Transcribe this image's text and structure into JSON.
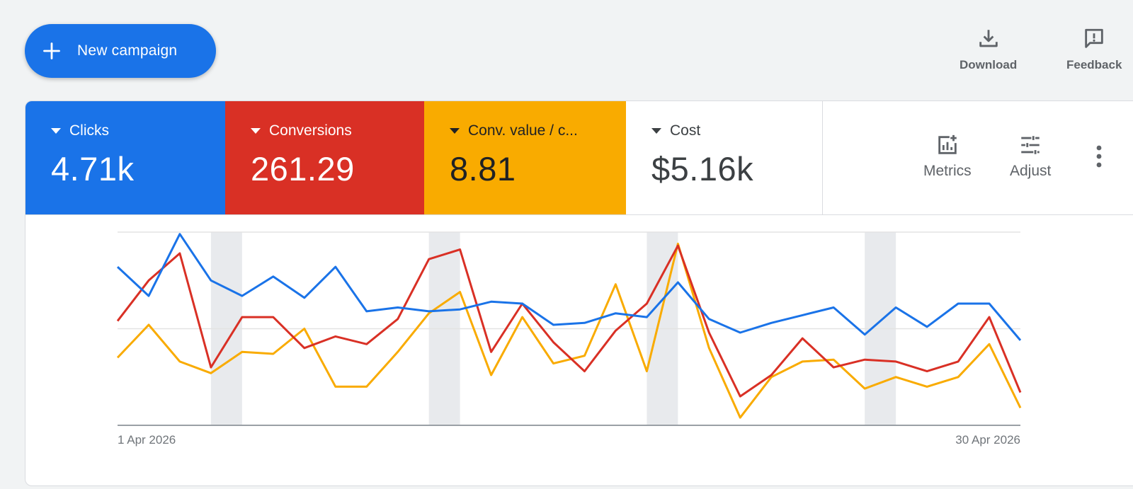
{
  "toolbar": {
    "new_campaign_label": "New campaign",
    "download_label": "Download",
    "feedback_label": "Feedback"
  },
  "metrics": {
    "clicks": {
      "name": "Clicks",
      "value": "4.71k",
      "color": "#1a73e8"
    },
    "conversions": {
      "name": "Conversions",
      "value": "261.29",
      "color": "#d93025"
    },
    "conv_value": {
      "name": "Conv. value / c...",
      "value": "8.81",
      "color": "#f9ab00"
    },
    "cost": {
      "name": "Cost",
      "value": "$5.16k"
    }
  },
  "tools": {
    "metrics_label": "Metrics",
    "adjust_label": "Adjust"
  },
  "icons": {
    "new_campaign": "plus-icon",
    "download": "download-icon",
    "feedback": "feedback-icon",
    "metrics": "add-chart-icon",
    "adjust": "tune-icon",
    "more": "more-vert-icon"
  },
  "chart_data": {
    "type": "line",
    "x": [
      "1 Apr 2026",
      "2 Apr 2026",
      "3 Apr 2026",
      "4 Apr 2026",
      "5 Apr 2026",
      "6 Apr 2026",
      "7 Apr 2026",
      "8 Apr 2026",
      "9 Apr 2026",
      "10 Apr 2026",
      "11 Apr 2026",
      "12 Apr 2026",
      "13 Apr 2026",
      "14 Apr 2026",
      "15 Apr 2026",
      "16 Apr 2026",
      "17 Apr 2026",
      "18 Apr 2026",
      "19 Apr 2026",
      "20 Apr 2026",
      "21 Apr 2026",
      "22 Apr 2026",
      "23 Apr 2026",
      "24 Apr 2026",
      "25 Apr 2026",
      "26 Apr 2026",
      "27 Apr 2026",
      "28 Apr 2026",
      "29 Apr 2026",
      "30 Apr 2026"
    ],
    "x_tick_labels": [
      "1 Apr 2026",
      "30 Apr 2026"
    ],
    "ylim": [
      0,
      100
    ],
    "grid": true,
    "weekend_bands": [
      [
        "4 Apr 2026",
        "5 Apr 2026"
      ],
      [
        "11 Apr 2026",
        "12 Apr 2026"
      ],
      [
        "18 Apr 2026",
        "19 Apr 2026"
      ],
      [
        "25 Apr 2026",
        "26 Apr 2026"
      ]
    ],
    "series": [
      {
        "name": "Clicks",
        "color": "#1a73e8",
        "values": [
          82,
          67,
          99,
          75,
          67,
          77,
          66,
          82,
          59,
          61,
          59,
          60,
          64,
          63,
          52,
          53,
          58,
          56,
          74,
          55,
          48,
          53,
          57,
          61,
          47,
          61,
          51,
          63,
          63,
          44
        ]
      },
      {
        "name": "Conversions",
        "color": "#d93025",
        "values": [
          54,
          75,
          89,
          30,
          56,
          56,
          40,
          46,
          42,
          55,
          86,
          91,
          38,
          63,
          43,
          28,
          49,
          63,
          93,
          48,
          15,
          26,
          45,
          30,
          34,
          33,
          28,
          33,
          56,
          17
        ]
      },
      {
        "name": "Conv. value / c...",
        "color": "#f9ab00",
        "values": [
          35,
          52,
          33,
          27,
          38,
          37,
          50,
          20,
          20,
          38,
          58,
          69,
          26,
          56,
          32,
          36,
          73,
          28,
          94,
          40,
          4,
          25,
          33,
          34,
          19,
          25,
          20,
          25,
          42,
          9
        ]
      }
    ]
  }
}
